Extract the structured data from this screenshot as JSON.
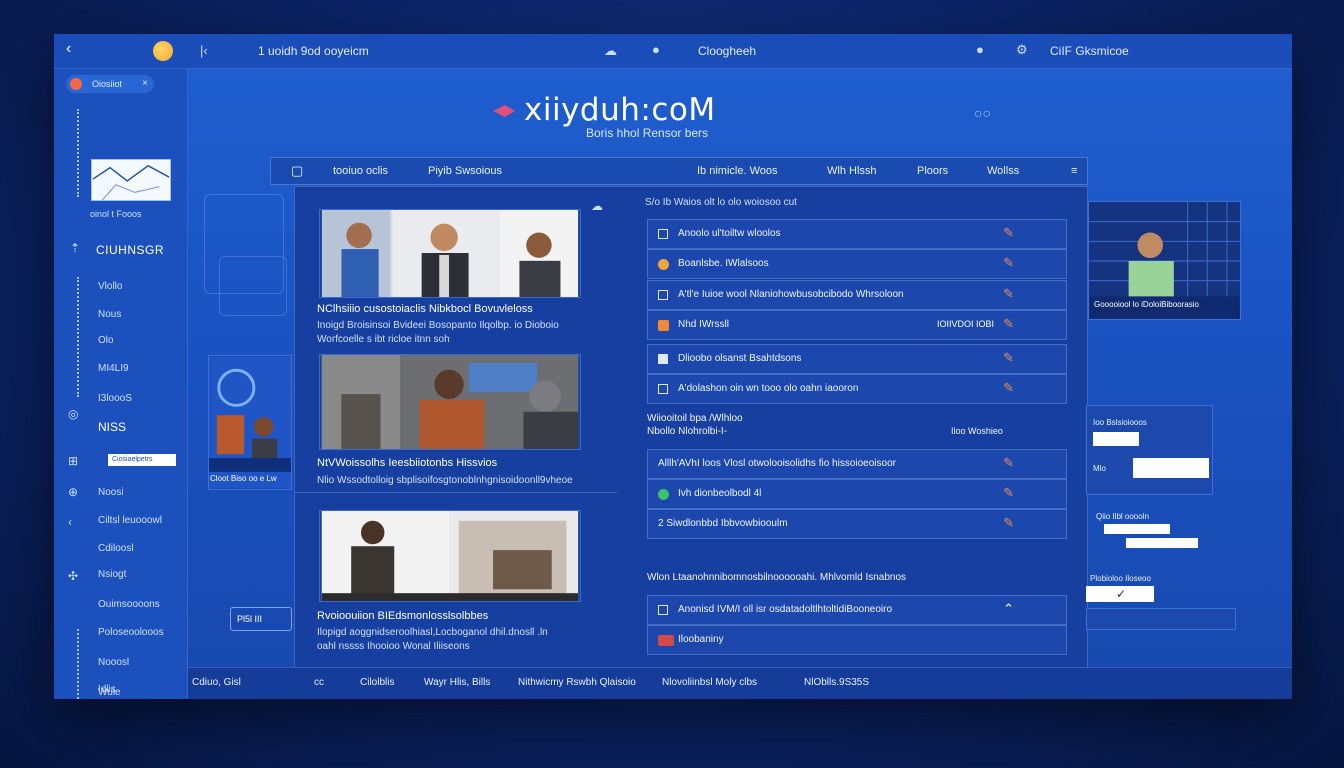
{
  "titlebar": {
    "path": "1 uoidh 9od ooyeicm",
    "center": "Cloogheeh",
    "right": "CiIF Gksmicoe"
  },
  "sidebar": {
    "pill": "Oiosiiot",
    "caption": "oinol t Fooos",
    "title": "CIUHNSGR",
    "items": [
      "Vlollo",
      "Nous",
      "Olo",
      "MI4LI9",
      "I3loooS",
      "NISS",
      "Noosi",
      "Ciltsl leuooowl",
      "Cdiloosl",
      "Nsiogt",
      "Ouimsoooons",
      "Poloseoolooos",
      "Nooosl",
      "Wuie",
      "Idlis"
    ],
    "chip": "Ciosiaelpetrs",
    "footer": "Cdiuo, Gisl"
  },
  "header": {
    "logo": "xiiyduh:coM",
    "tagline": "Boris hhol Rensor bers"
  },
  "navbar": {
    "items": [
      "tooiuo oclis",
      "Piyib Swsoious",
      "Ib nimicle. Woos",
      "Wlh Hlssh",
      "Ploors",
      "Wollss"
    ]
  },
  "news": [
    {
      "title": "NClhsiiio cusostoiaclis Nibkbocl Bovuvleloss",
      "subtitle": "Inoigd Broisinsoi Bvideei Bosopanto Ilqolbp. io Dioboio",
      "subtitle2": "Worfcoelle s ibt ricloe itnn soh"
    },
    {
      "title": "NtVWoissolhs Ieesbiiotonbs Hissvios",
      "subtitle": "Nlio Wssodtolloig sbplisoifosgtonoblnhgnisoidoonll9vheoe"
    },
    {
      "title": "Rvoioouiion BIEdsmonlosslsolbbes",
      "subtitle": "Ilopigd aoggnidseroolhiasl,Locboganol dhil.dnosll .ln",
      "subtitle2": "oahl nssss Ihooioo Wonal Iliiseons"
    }
  ],
  "list": {
    "header": "S/o Ib Waios   olt   lo  olo  woiosoo  cut",
    "rows": [
      {
        "type": "check",
        "label": "Anoolo ul'toiltw  wloolos"
      },
      {
        "type": "bullet",
        "color": "#f0a43a",
        "label": "Boanlsbe. IWlalsoos"
      },
      {
        "type": "check",
        "label": "A'tl'e Iuioe wool Nlaniohowbusobcibodo Whrsoloon"
      },
      {
        "type": "bullet",
        "color": "#f08a3a",
        "label": "Nhd IWrssll",
        "badge": "IOIIVDOI IOBI"
      },
      {
        "type": "check",
        "label": "Dlioobo olsanst Bsahtdsons"
      },
      {
        "type": "check",
        "label": "A'dolashon oin wn tooo olo oahn iaooron"
      },
      {
        "type": "group",
        "label": "Wiiooitoil bpa  /Wlhloo",
        "label2": "Nbollo Nlohrolbi-I-",
        "badge": "Iloo Woshieo"
      },
      {
        "type": "plain",
        "label": "Alllh'AVhI loos  Vlosl otwolooisolidhs fio hissoioeoisoor"
      },
      {
        "type": "bullet",
        "color": "#3cc26a",
        "label": "Ivh dionbeolbodl 4l"
      },
      {
        "type": "num",
        "label": "2   Siwdlonbbd Ibbvowbiooulm"
      },
      {
        "type": "group",
        "label": "Wlon Ltaanohnnibomnosbilnoooooahi. Mhlvomld Isnabnos"
      },
      {
        "type": "check",
        "label": "Anonisd IVM/I  oll isr osdatadoltlhtoltidiBooneoiro"
      },
      {
        "type": "bullet",
        "color": "#d24a4a",
        "label": "Iloobaniny"
      }
    ]
  },
  "footer": {
    "items": [
      "Cilolblis",
      "Wayr Hlis, Bills",
      "Nithwicmy Rswbh  Qlaisoio",
      "Nlovoliinbsl   Moly clbs",
      "NlOblls.9S35S"
    ]
  },
  "widgets": {
    "video_caption": "Gooooiool lo iDoloiBiboorasio",
    "form_label1": "Ioo Bslsioiooos",
    "form_label2": "Mlo",
    "check_label": "Qiio Ilbl ooooln",
    "check_label2": "Plobioloo Iloseoo",
    "left_caption": "Cloot Biso oo e Lw",
    "small_button": "Pl5l III"
  }
}
